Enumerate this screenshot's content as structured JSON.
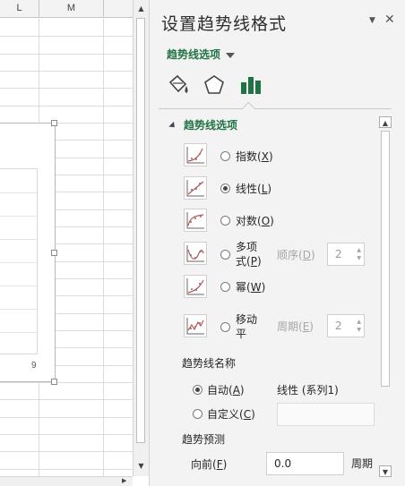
{
  "sheet": {
    "columns": [
      "L",
      "M"
    ],
    "chart_tick_label": "9"
  },
  "pane": {
    "title": "设置趋势线格式",
    "options_dropdown": "趋势线选项",
    "section_title": "趋势线选项",
    "trendline_types": [
      {
        "label": "指数",
        "key": "X",
        "checked": false
      },
      {
        "label": "线性",
        "key": "L",
        "checked": true
      },
      {
        "label": "对数",
        "key": "O",
        "checked": false
      },
      {
        "label_line1": "多项",
        "label_line2": "式",
        "key": "P",
        "checked": false,
        "param_label": "顺序",
        "param_key": "D",
        "param_value": "2"
      },
      {
        "label": "幂",
        "key": "W",
        "checked": false
      },
      {
        "label_line1": "移动",
        "label_line2": "平",
        "checked": false,
        "param_label": "周期",
        "param_key": "E",
        "param_value": "2"
      }
    ],
    "name_section": {
      "title": "趋势线名称",
      "auto_label": "自动",
      "auto_key": "A",
      "auto_value": "线性 (系列1)",
      "custom_label": "自定义",
      "custom_key": "C"
    },
    "forecast_section": {
      "title": "趋势预测",
      "forward_label": "向前",
      "forward_key": "F",
      "forward_value": "0.0",
      "unit": "周期"
    }
  },
  "colors": {
    "accent": "#217346"
  }
}
